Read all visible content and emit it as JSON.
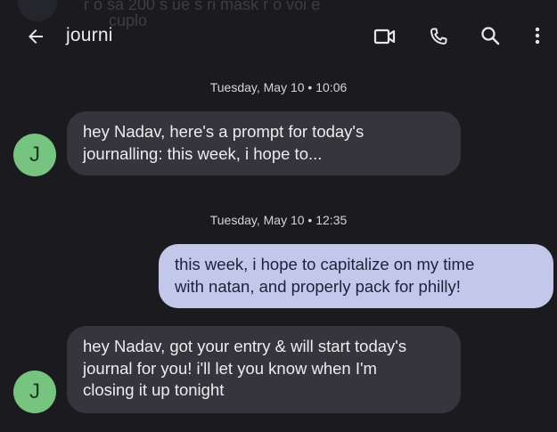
{
  "app_bar": {
    "back_icon": "arrow-left-icon",
    "title": "journi",
    "actions": [
      "video-call-icon",
      "phone-icon",
      "search-icon",
      "more-vert-icon"
    ]
  },
  "background_ghost": {
    "line1": "r o  sa  200  s  ue   s  ri mask  r o  voi  e",
    "line2": "cuplo"
  },
  "messages": [
    {
      "type": "timestamp",
      "text": "Tuesday, May 10 • 10:06"
    },
    {
      "type": "incoming",
      "avatar_letter": "J",
      "text": "hey Nadav, here's a prompt for today's\njournalling: this week, i hope to..."
    },
    {
      "type": "timestamp",
      "text": "Tuesday, May 10 • 12:35"
    },
    {
      "type": "outgoing",
      "text": "this week, i hope to capitalize on my time\nwith natan, and properly pack for philly!"
    },
    {
      "type": "incoming",
      "avatar_letter": "J",
      "text": "hey Nadav, got your entry & will start today's\njournal for you! i'll let you know when I'm\nclosing it up tonight"
    }
  ],
  "colors": {
    "background": "#1b1b1f",
    "incoming_bubble": "#35353b",
    "outgoing_bubble": "#c3c8ea",
    "avatar": "#76c47f"
  }
}
